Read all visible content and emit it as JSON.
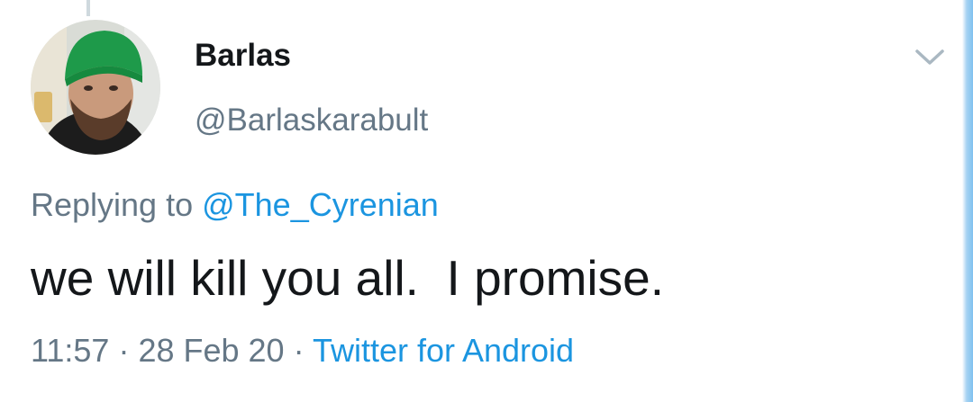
{
  "tweet": {
    "display_name": "Barlas",
    "handle": "@Barlaskarabult",
    "reply_prefix": "Replying to",
    "reply_to": "@The_Cyrenian",
    "text": "we will kill you all.  I promise.",
    "time": "11:57",
    "separator": "·",
    "date": "28 Feb 20",
    "source": "Twitter for Android"
  },
  "icons": {
    "avatar": "user-avatar-photo",
    "menu": "chevron-down-icon"
  },
  "colors": {
    "primary_text": "#14171a",
    "secondary_text": "#657786",
    "link": "#1b95e0"
  }
}
